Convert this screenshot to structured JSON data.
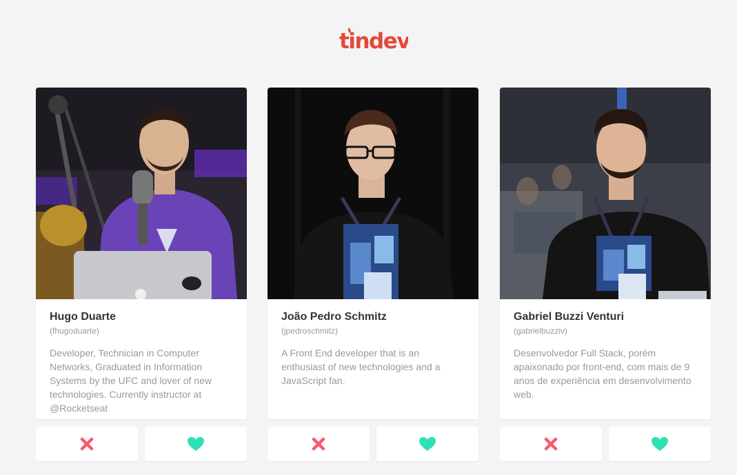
{
  "app": {
    "logo_text": "tindev"
  },
  "colors": {
    "brand": "#e5493a",
    "dislike": "#f85a6e",
    "like": "#2fe0b5",
    "name_text": "#333333",
    "muted_text": "#999999",
    "background": "#f4f4f4"
  },
  "developers": [
    {
      "name": "Hugo Duarte",
      "user": "(fhugoduarte)",
      "bio": "Developer, Technician in Computer Networks, Graduated in Information Systems by the UFC and lover of new technologies. Currently instructor at @Rocketseat",
      "dislike_icon": "x-icon",
      "like_icon": "heart-icon"
    },
    {
      "name": "João Pedro Schmitz",
      "user": "(jpedroschmitz)",
      "bio": "A Front End developer that is an enthusiast of new technologies and a JavaScript fan.",
      "dislike_icon": "x-icon",
      "like_icon": "heart-icon"
    },
    {
      "name": "Gabriel Buzzi Venturi",
      "user": "(gabrielbuzziv)",
      "bio": "Desenvolvedor Full Stack, porém apaixonado por front-end, com mais de 9 anos de experiência em desenvolvimento web.",
      "dislike_icon": "x-icon",
      "like_icon": "heart-icon"
    }
  ]
}
